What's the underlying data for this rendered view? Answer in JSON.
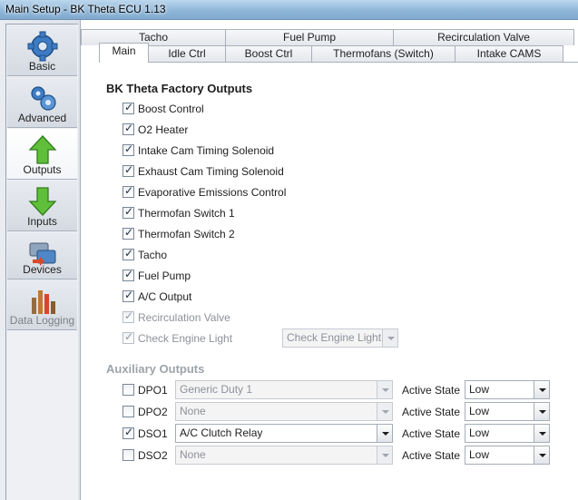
{
  "window": {
    "title": "Main Setup - BK Theta ECU 1.13"
  },
  "sidebar": {
    "items": [
      {
        "label": "Basic",
        "icon": "gear-icon"
      },
      {
        "label": "Advanced",
        "icon": "gears-icon"
      },
      {
        "label": "Outputs",
        "icon": "arrow-up-icon"
      },
      {
        "label": "Inputs",
        "icon": "arrow-down-icon"
      },
      {
        "label": "Devices",
        "icon": "devices-icon"
      },
      {
        "label": "Data Logging",
        "icon": "bar-chart-icon"
      }
    ],
    "active": "Outputs"
  },
  "tabs": {
    "row1": [
      "Tacho",
      "Fuel Pump",
      "Recirculation Valve"
    ],
    "row2": [
      "Main",
      "Idle Ctrl",
      "Boost Ctrl",
      "Thermofans (Switch)",
      "Intake CAMS"
    ],
    "active": "Main"
  },
  "factory": {
    "title": "BK Theta Factory Outputs",
    "items": [
      {
        "label": "Boost Control",
        "checked": true,
        "enabled": true
      },
      {
        "label": "O2 Heater",
        "checked": true,
        "enabled": true
      },
      {
        "label": "Intake Cam Timing Solenoid",
        "checked": true,
        "enabled": true
      },
      {
        "label": "Exhaust Cam Timing Solenoid",
        "checked": true,
        "enabled": true
      },
      {
        "label": "Evaporative Emissions Control",
        "checked": true,
        "enabled": true
      },
      {
        "label": "Thermofan Switch 1",
        "checked": true,
        "enabled": true
      },
      {
        "label": "Thermofan Switch 2",
        "checked": true,
        "enabled": true
      },
      {
        "label": "Tacho",
        "checked": true,
        "enabled": true
      },
      {
        "label": "Fuel Pump",
        "checked": true,
        "enabled": true
      },
      {
        "label": "A/C Output",
        "checked": true,
        "enabled": true
      },
      {
        "label": "Recirculation Valve",
        "checked": true,
        "enabled": false
      },
      {
        "label": "Check Engine Light",
        "checked": true,
        "enabled": false
      }
    ],
    "check_engine_select": "Check Engine Light"
  },
  "auxiliary": {
    "title": "Auxiliary Outputs",
    "active_state_label": "Active State",
    "rows": [
      {
        "name": "DPO1",
        "checked": false,
        "function": "Generic Duty 1",
        "enabled": false,
        "state": "Low"
      },
      {
        "name": "DPO2",
        "checked": false,
        "function": "None",
        "enabled": false,
        "state": "Low"
      },
      {
        "name": "DSO1",
        "checked": true,
        "function": "A/C Clutch Relay",
        "enabled": true,
        "state": "Low"
      },
      {
        "name": "DSO2",
        "checked": false,
        "function": "None",
        "enabled": false,
        "state": "Low"
      }
    ]
  }
}
